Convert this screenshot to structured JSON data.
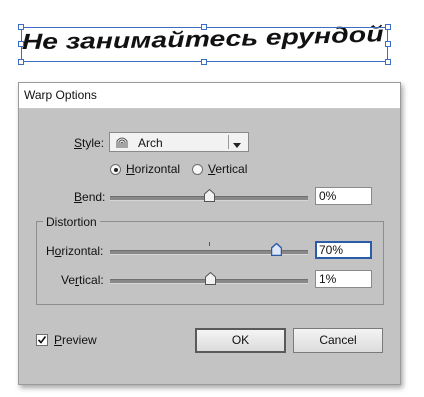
{
  "canvas": {
    "warped_text": "Не занимайтесь ерундой"
  },
  "dialog": {
    "title": "Warp Options",
    "style": {
      "label": "Style:",
      "value": "Arch",
      "icon": "arch-icon"
    },
    "orientation": {
      "options": [
        "Horizontal",
        "Vertical"
      ],
      "selected": "Horizontal"
    },
    "bend": {
      "label": "Bend:",
      "value": "0%",
      "slider_percent": 0
    },
    "distortion": {
      "title": "Distortion",
      "horizontal": {
        "label": "Horizontal:",
        "value": "70%",
        "slider_percent": 70
      },
      "vertical": {
        "label": "Vertical:",
        "value": "1%",
        "slider_percent": 1
      }
    },
    "preview": {
      "label": "Preview",
      "checked": true
    },
    "ok_label": "OK",
    "cancel_label": "Cancel"
  },
  "colors": {
    "selection": "#3b6ec2",
    "dialog_bg": "#c3c3c3",
    "focus": "#2a5caa"
  }
}
